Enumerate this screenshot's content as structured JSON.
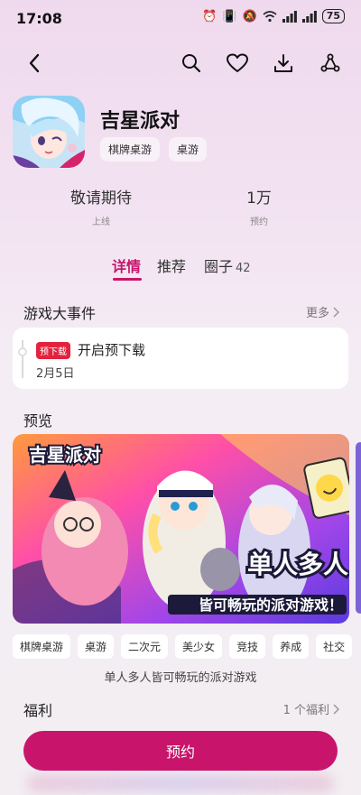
{
  "status": {
    "time": "17:08",
    "battery": "75",
    "icons": [
      "alarm-icon",
      "vibrate-icon",
      "mute-icon",
      "wifi-icon",
      "signal-icon",
      "signal-icon"
    ]
  },
  "nav": {
    "back": "back-icon",
    "actions": [
      "search-icon",
      "heart-icon",
      "download-icon",
      "share-icon"
    ]
  },
  "app": {
    "title": "吉星派对",
    "tags": [
      "棋牌桌游",
      "桌游"
    ]
  },
  "stats": [
    {
      "value": "敬请期待",
      "label": "上线"
    },
    {
      "value": "1万",
      "label": "预约"
    }
  ],
  "tabs": {
    "items": [
      {
        "label": "详情"
      },
      {
        "label": "推荐"
      },
      {
        "label": "圈子",
        "count": "42"
      }
    ],
    "active": 0
  },
  "events": {
    "title": "游戏大事件",
    "more": "更多",
    "item": {
      "badge": "预下载",
      "title": "开启预下载",
      "date": "2月5日"
    }
  },
  "preview": {
    "title": "预览",
    "banner_logo": "吉星派对",
    "banner_headline": "单人多人",
    "banner_sub": "皆可畅玩的派对游戏！"
  },
  "genres": [
    "棋牌桌游",
    "桌游",
    "二次元",
    "美少女",
    "竞技",
    "养成",
    "社交"
  ],
  "description": "单人多人皆可畅玩的派对游戏",
  "benefits": {
    "title": "福利",
    "more": "1 个福利"
  },
  "cta": {
    "label": "预约"
  },
  "colors": {
    "accent": "#c8156b",
    "badge_red": "#e4223e"
  }
}
